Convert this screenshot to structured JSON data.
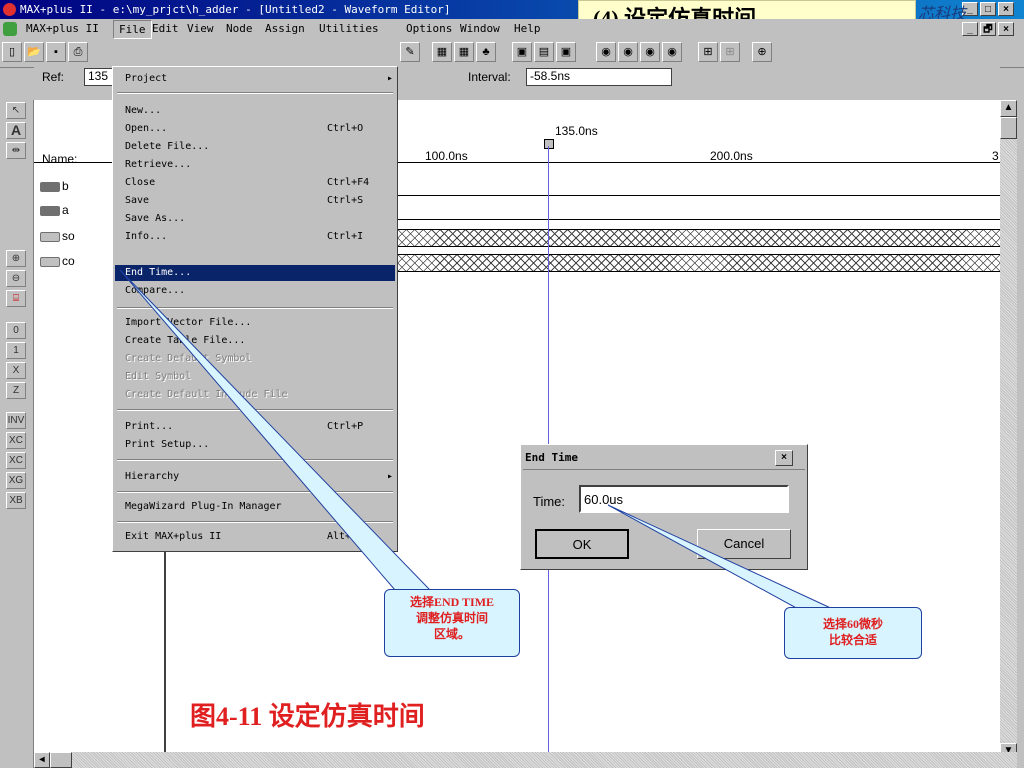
{
  "window": {
    "title": "MAX+plus II - e:\\my_prjct\\h_adder - [Untitled2 - Waveform Editor]",
    "watermark": "芯科技",
    "min": "_",
    "max": "□",
    "close": "×",
    "child_min": "_",
    "child_restore": "🗗",
    "child_close": "×"
  },
  "annotation": {
    "step_title": "(4) 设定仿真时间。",
    "figure_caption": "图4-11 设定仿真时间",
    "callout_left": [
      "选择END TIME",
      "调整仿真时间",
      "区域。"
    ],
    "callout_right": [
      "选择60微秒",
      "比较合适"
    ]
  },
  "menubar": {
    "items": [
      "MAX+plus II",
      "File",
      "Edit",
      "View",
      "Node",
      "Assign",
      "Utilities",
      "Options",
      "Window",
      "Help"
    ]
  },
  "waveform": {
    "ref_label": "Ref:",
    "ref_value": "135",
    "interval_label": "Interval:",
    "interval_value": "-58.5ns",
    "cursor_time": "135.0ns",
    "time_marks": [
      "100.0ns",
      "200.0ns",
      "3"
    ],
    "name_header": "Name:",
    "signals": [
      "b",
      "a",
      "so",
      "co"
    ]
  },
  "file_menu": {
    "items": [
      {
        "label": "Project",
        "accel": "▸",
        "enabled": true
      },
      {
        "label": "New...",
        "accel": "",
        "enabled": true
      },
      {
        "label": "Open...",
        "accel": "Ctrl+O",
        "enabled": true
      },
      {
        "label": "Delete File...",
        "accel": "",
        "enabled": true
      },
      {
        "label": "Retrieve...",
        "accel": "",
        "enabled": true
      },
      {
        "label": "Close",
        "accel": "Ctrl+F4",
        "enabled": true
      },
      {
        "label": "Save",
        "accel": "Ctrl+S",
        "enabled": true
      },
      {
        "label": "Save As...",
        "accel": "",
        "enabled": true
      },
      {
        "label": "Info...",
        "accel": "Ctrl+I",
        "enabled": true
      },
      {
        "label": "End Time...",
        "accel": "",
        "enabled": true,
        "selected": true
      },
      {
        "label": "Compare...",
        "accel": "",
        "enabled": true
      },
      {
        "label": "Import Vector File...",
        "accel": "",
        "enabled": true
      },
      {
        "label": "Create Table File...",
        "accel": "",
        "enabled": true
      },
      {
        "label": "Create Default Symbol",
        "accel": "",
        "enabled": false
      },
      {
        "label": "Edit Symbol",
        "accel": "",
        "enabled": false
      },
      {
        "label": "Create Default Include File",
        "accel": "",
        "enabled": false
      },
      {
        "label": "Print...",
        "accel": "Ctrl+P",
        "enabled": true
      },
      {
        "label": "Print Setup...",
        "accel": "",
        "enabled": true
      },
      {
        "label": "Hierarchy",
        "accel": "▸",
        "enabled": true
      },
      {
        "label": "MegaWizard Plug-In Manager",
        "accel": "",
        "enabled": true
      },
      {
        "label": "Exit MAX+plus II",
        "accel": "Alt+F4",
        "enabled": true
      }
    ]
  },
  "dialog": {
    "title": "End Time",
    "close": "×",
    "time_label": "Time:",
    "time_value": "60.0us",
    "ok_label": "OK",
    "cancel_label": "Cancel"
  },
  "colors": {
    "titlebar": "#000080",
    "menu_selected": "#0a246a",
    "callout_text": "#e02020",
    "step_title_bg": "#ffffcc"
  }
}
